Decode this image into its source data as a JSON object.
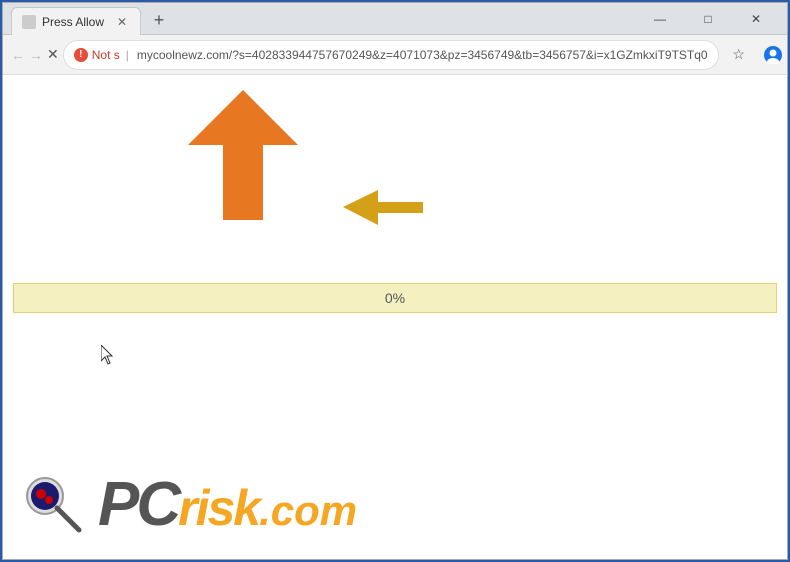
{
  "window": {
    "title": "Press Allow",
    "tab_title": "Press Allow",
    "controls": {
      "minimize": "—",
      "maximize": "□",
      "close": "✕"
    }
  },
  "toolbar": {
    "back_label": "←",
    "forward_label": "→",
    "refresh_label": "✕",
    "security_label": "Not s",
    "url": "mycoolnewz.com/?s=402833944757670249&z=4071073&pz=3456749&tb=3456757&i=x1GZmkxiT9TSTq0",
    "bookmark_label": "☆",
    "new_tab_label": "+"
  },
  "content": {
    "progress_label": "0%",
    "arrows": {
      "big_arrow_color": "#e87722",
      "small_arrow_color": "#d4a017"
    }
  },
  "watermark": {
    "pc_text": "PC",
    "risk_text": "risk",
    "dot_com_text": ".com"
  }
}
